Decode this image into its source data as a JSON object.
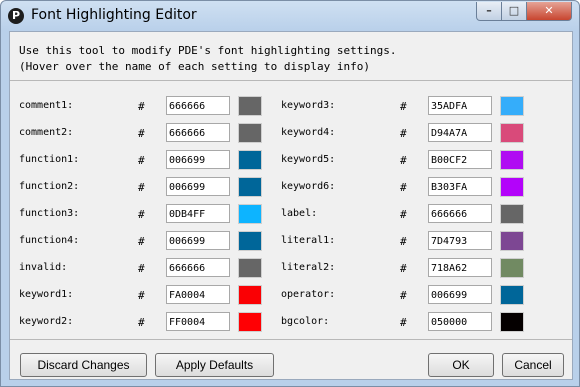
{
  "window": {
    "title": "Font Highlighting Editor",
    "app_icon_glyph": "P",
    "min_glyph": "–",
    "max_glyph": "□",
    "close_glyph": "✕"
  },
  "info": {
    "line1": "Use this tool to modify PDE's font highlighting settings.",
    "line2": "(Hover over the name of each setting to display info)"
  },
  "hash": "#",
  "left": [
    {
      "label": "comment1:",
      "hex": "666666",
      "color": "#666666"
    },
    {
      "label": "comment2:",
      "hex": "666666",
      "color": "#666666"
    },
    {
      "label": "function1:",
      "hex": "006699",
      "color": "#006699"
    },
    {
      "label": "function2:",
      "hex": "006699",
      "color": "#006699"
    },
    {
      "label": "function3:",
      "hex": "0DB4FF",
      "color": "#0DB4FF"
    },
    {
      "label": "function4:",
      "hex": "006699",
      "color": "#006699"
    },
    {
      "label": "invalid:",
      "hex": "666666",
      "color": "#666666"
    },
    {
      "label": "keyword1:",
      "hex": "FA0004",
      "color": "#FA0004"
    },
    {
      "label": "keyword2:",
      "hex": "FF0004",
      "color": "#FF0004"
    }
  ],
  "right": [
    {
      "label": "keyword3:",
      "hex": "35ADFA",
      "color": "#35ADFA"
    },
    {
      "label": "keyword4:",
      "hex": "D94A7A",
      "color": "#D94A7A"
    },
    {
      "label": "keyword5:",
      "hex": "B00CF2",
      "color": "#B00CF2"
    },
    {
      "label": "keyword6:",
      "hex": "B303FA",
      "color": "#B303FA"
    },
    {
      "label": "label:",
      "hex": "666666",
      "color": "#666666"
    },
    {
      "label": "literal1:",
      "hex": "7D4793",
      "color": "#7D4793"
    },
    {
      "label": "literal2:",
      "hex": "718A62",
      "color": "#718A62"
    },
    {
      "label": "operator:",
      "hex": "006699",
      "color": "#006699"
    },
    {
      "label": "bgcolor:",
      "hex": "050000",
      "color": "#050000"
    }
  ],
  "buttons": {
    "discard": "Discard Changes",
    "apply_defaults": "Apply Defaults",
    "ok": "OK",
    "cancel": "Cancel"
  }
}
